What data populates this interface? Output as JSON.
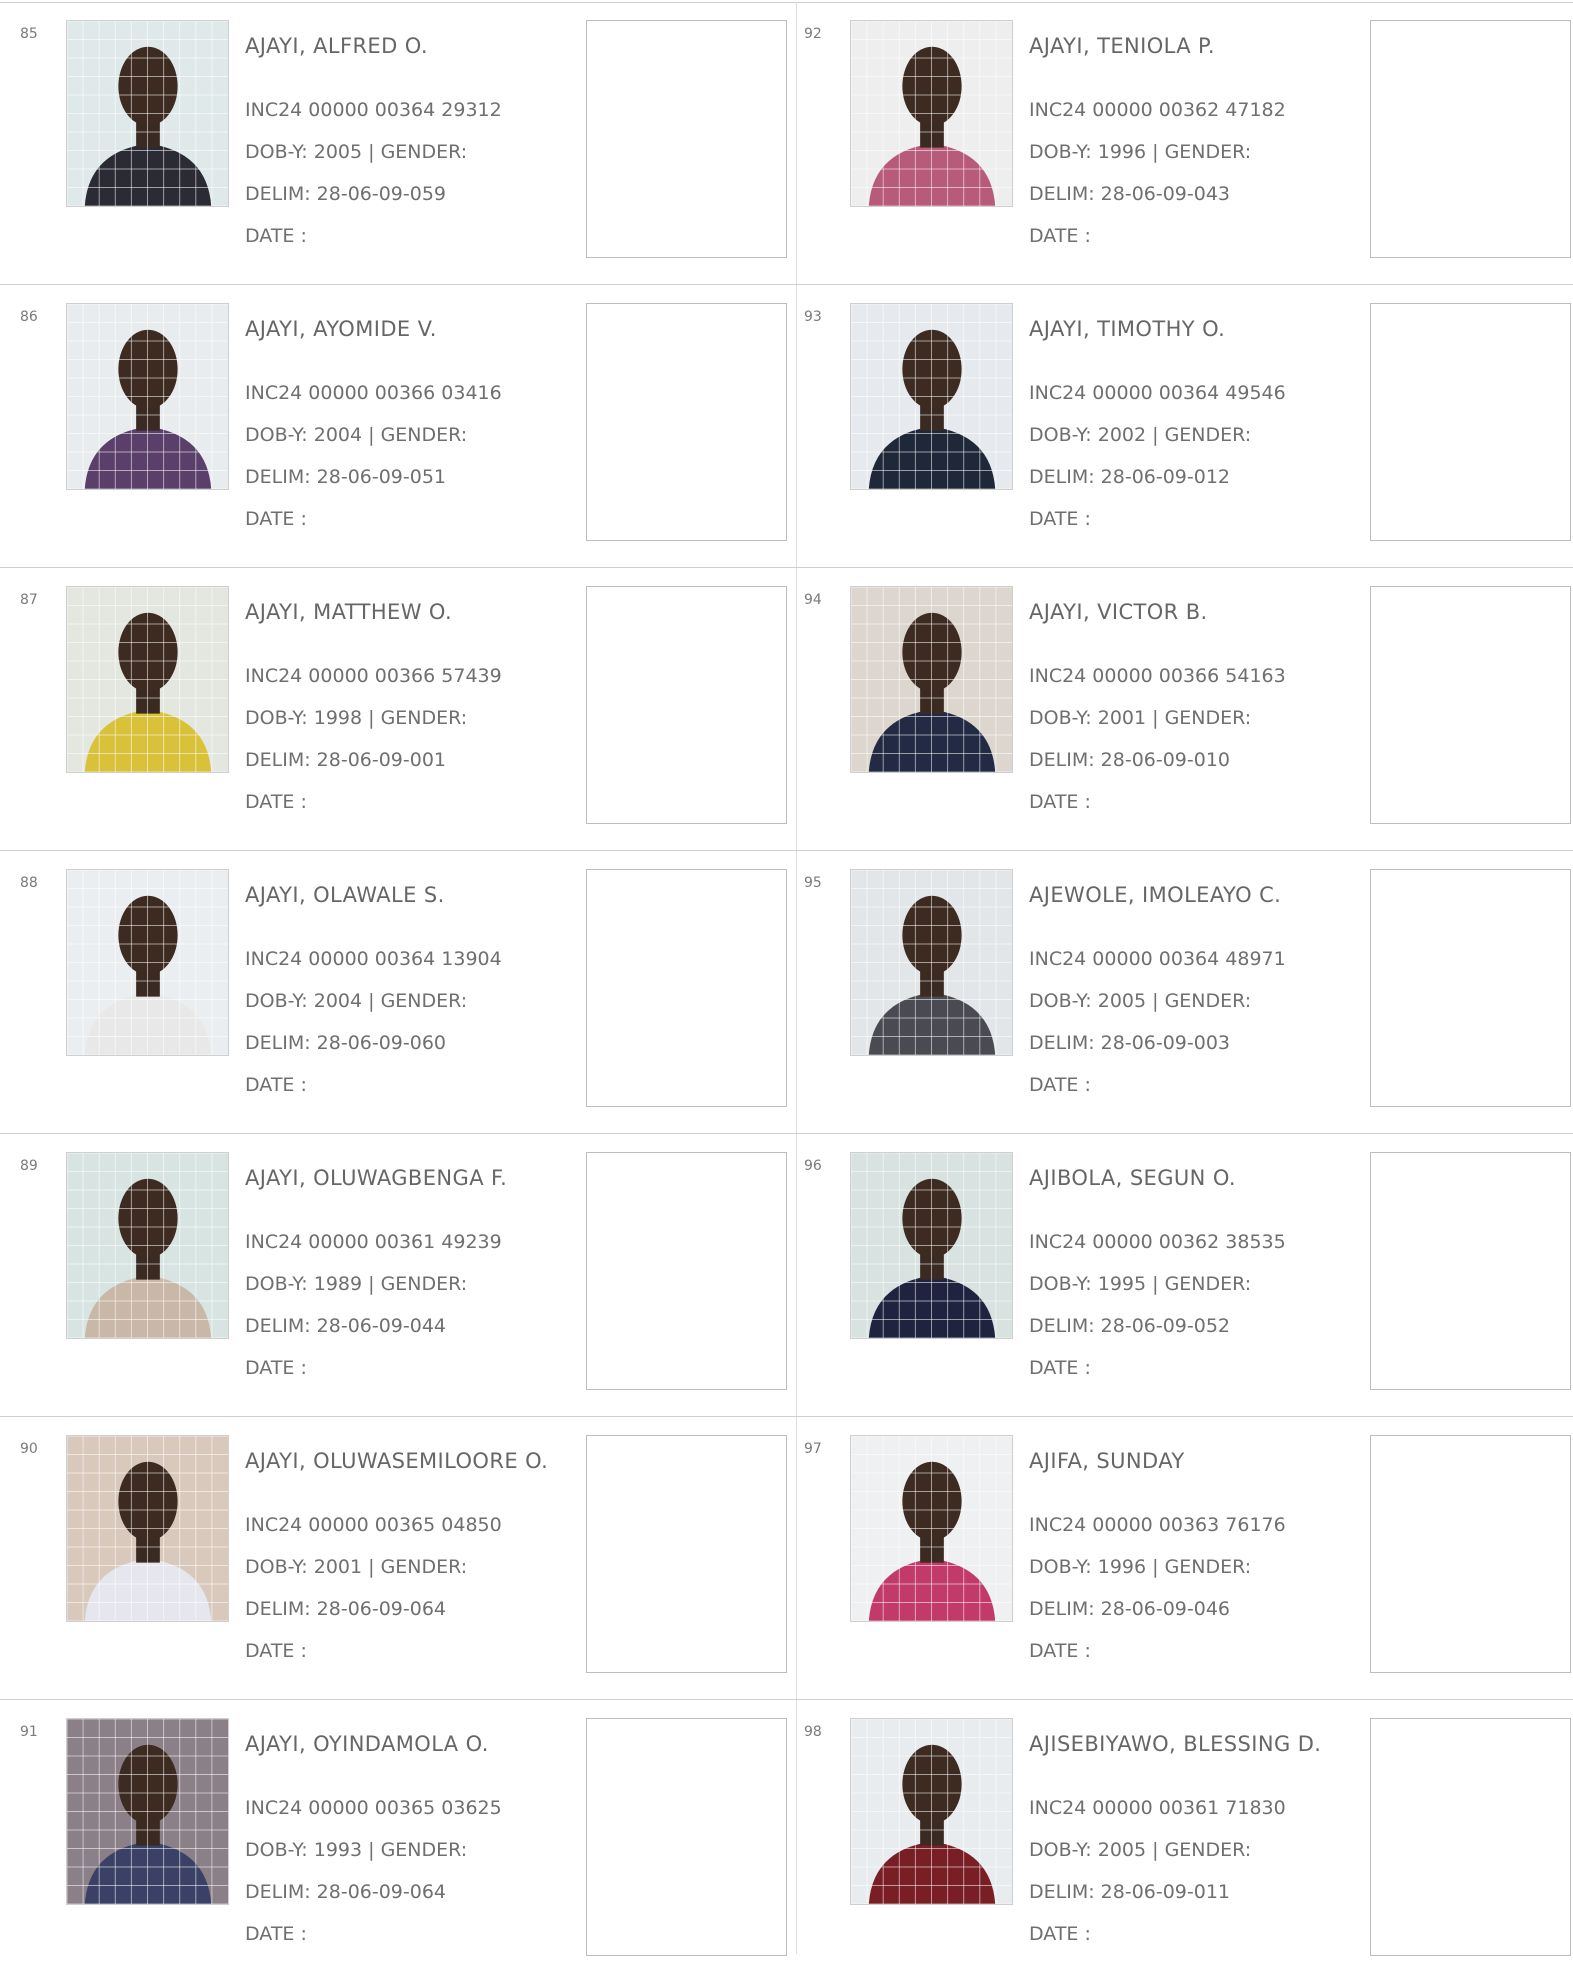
{
  "colors": {
    "rule": "#cfcfcf",
    "text": "#6f6f6f"
  },
  "left_column": [
    {
      "num": "85",
      "name": "AJAYI, ALFRED O.",
      "inc": "INC24 00000 00364 29312",
      "dob": "DOB-Y: 2005  | GENDER:",
      "delim": "DELIM: 28-06-09-059",
      "date": "DATE  :"
    },
    {
      "num": "86",
      "name": "AJAYI, AYOMIDE V.",
      "inc": "INC24 00000 00366 03416",
      "dob": "DOB-Y: 2004  | GENDER:",
      "delim": "DELIM: 28-06-09-051",
      "date": "DATE  :"
    },
    {
      "num": "87",
      "name": "AJAYI, MATTHEW O.",
      "inc": "INC24 00000 00366 57439",
      "dob": "DOB-Y: 1998  | GENDER:",
      "delim": "DELIM: 28-06-09-001",
      "date": "DATE  :"
    },
    {
      "num": "88",
      "name": "AJAYI, OLAWALE S.",
      "inc": "INC24 00000 00364 13904",
      "dob": "DOB-Y: 2004  | GENDER:",
      "delim": "DELIM: 28-06-09-060",
      "date": "DATE  :"
    },
    {
      "num": "89",
      "name": "AJAYI, OLUWAGBENGA F.",
      "inc": "INC24 00000 00361 49239",
      "dob": "DOB-Y: 1989  | GENDER:",
      "delim": "DELIM: 28-06-09-044",
      "date": "DATE  :"
    },
    {
      "num": "90",
      "name": "AJAYI, OLUWASEMILOORE O.",
      "inc": "INC24 00000 00365 04850",
      "dob": "DOB-Y: 2001  | GENDER:",
      "delim": "DELIM: 28-06-09-064",
      "date": "DATE  :"
    },
    {
      "num": "91",
      "name": "AJAYI, OYINDAMOLA O.",
      "inc": "INC24 00000 00365 03625",
      "dob": "DOB-Y: 1993  | GENDER:",
      "delim": "DELIM: 28-06-09-064",
      "date": "DATE  :"
    }
  ],
  "right_column": [
    {
      "num": "92",
      "name": "AJAYI, TENIOLA P.",
      "inc": "INC24 00000 00362 47182",
      "dob": "DOB-Y: 1996  | GENDER:",
      "delim": "DELIM: 28-06-09-043",
      "date": "DATE  :"
    },
    {
      "num": "93",
      "name": "AJAYI, TIMOTHY O.",
      "inc": "INC24 00000 00364 49546",
      "dob": "DOB-Y: 2002  | GENDER:",
      "delim": "DELIM: 28-06-09-012",
      "date": "DATE  :"
    },
    {
      "num": "94",
      "name": "AJAYI, VICTOR B.",
      "inc": "INC24 00000 00366 54163",
      "dob": "DOB-Y: 2001  | GENDER:",
      "delim": "DELIM: 28-06-09-010",
      "date": "DATE  :"
    },
    {
      "num": "95",
      "name": "AJEWOLE, IMOLEAYO C.",
      "inc": "INC24 00000 00364 48971",
      "dob": "DOB-Y: 2005  | GENDER:",
      "delim": "DELIM: 28-06-09-003",
      "date": "DATE  :"
    },
    {
      "num": "96",
      "name": "AJIBOLA, SEGUN O.",
      "inc": "INC24 00000 00362 38535",
      "dob": "DOB-Y: 1995  | GENDER:",
      "delim": "DELIM: 28-06-09-052",
      "date": "DATE  :"
    },
    {
      "num": "97",
      "name": "AJIFA, SUNDAY",
      "inc": "INC24 00000 00363 76176",
      "dob": "DOB-Y: 1996  | GENDER:",
      "delim": "DELIM: 28-06-09-046",
      "date": "DATE  :"
    },
    {
      "num": "98",
      "name": "AJISEBIYAWO, BLESSING D.",
      "inc": "INC24 00000 00361 71830",
      "dob": "DOB-Y: 2005  | GENDER:",
      "delim": "DELIM: 28-06-09-011",
      "date": "DATE  :"
    }
  ]
}
